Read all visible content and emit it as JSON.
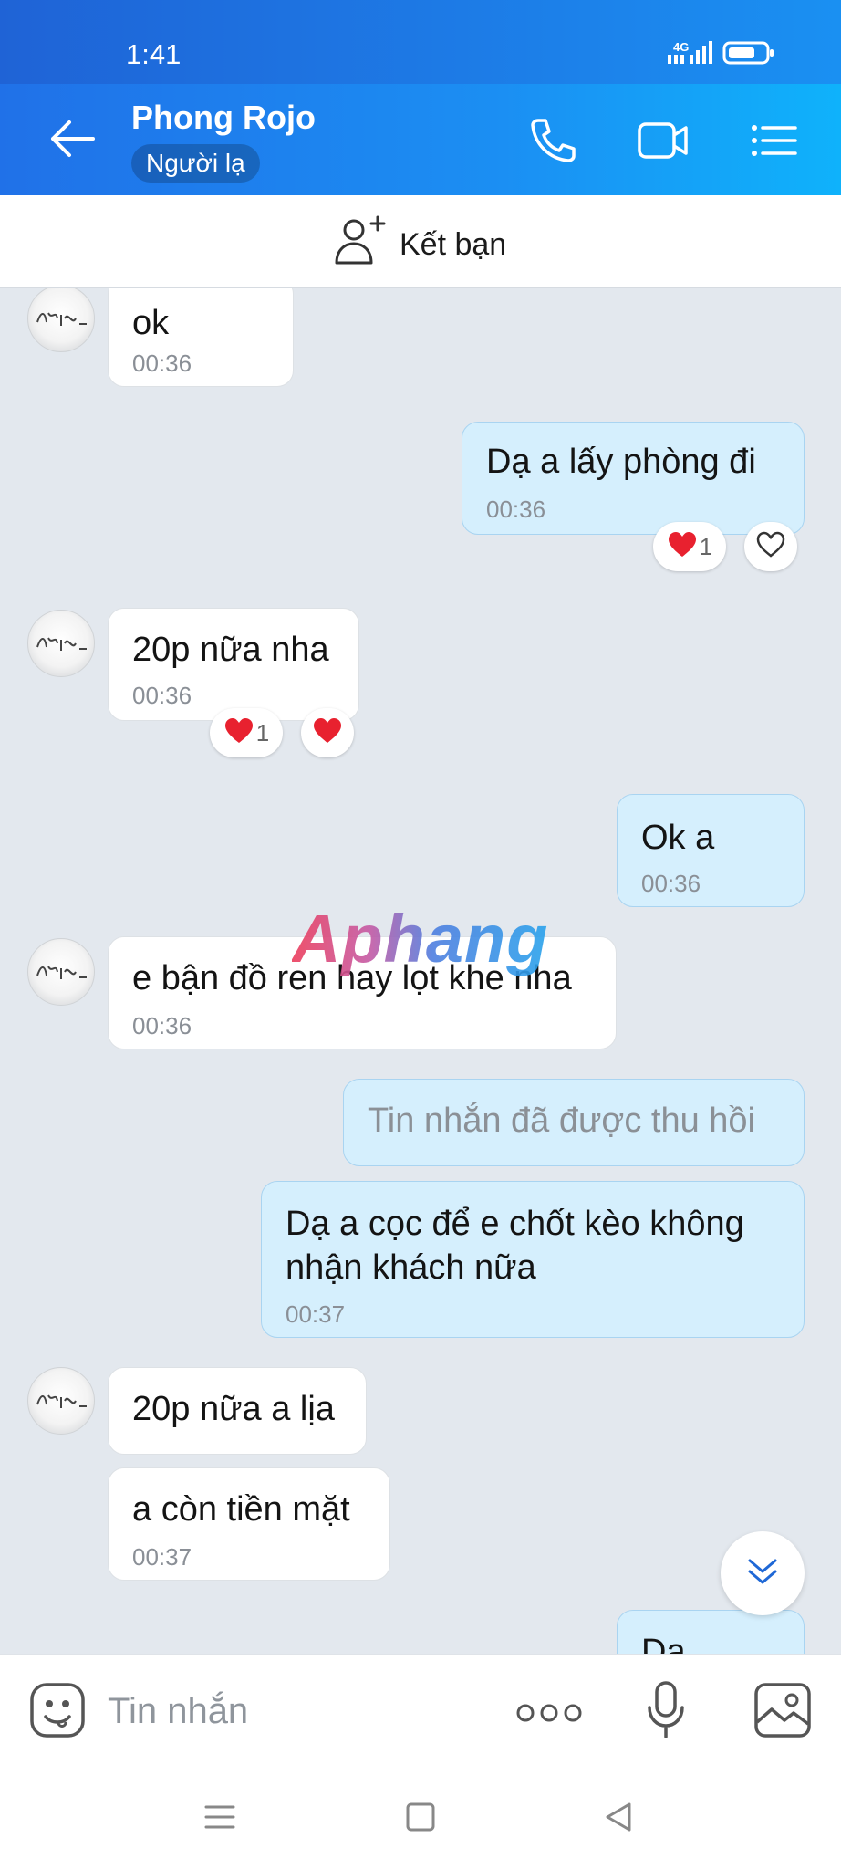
{
  "status_bar": {
    "time": "1:41",
    "network": "4G"
  },
  "header": {
    "title": "Phong Rojo",
    "badge": "Người lạ"
  },
  "add_friend": {
    "label": "Kết bạn"
  },
  "messages": [
    {
      "text": "ok",
      "time": "00:36"
    },
    {
      "text": "Dạ a lấy phòng đi",
      "time": "00:36",
      "reaction_count": "1"
    },
    {
      "text": "20p nữa nha",
      "time": "00:36",
      "reaction_count": "1"
    },
    {
      "text": "Ok a",
      "time": "00:36"
    },
    {
      "text": "e bận đồ ren hay lọt khe nha",
      "time": "00:36"
    },
    {
      "text": "Tin nhắn đã được thu hồi"
    },
    {
      "line1": "Dạ a cọc để e chốt kèo không",
      "line2": "nhận khách nữa",
      "time": "00:37"
    },
    {
      "text": "20p nữa a lịa"
    },
    {
      "text": "a còn tiền mặt",
      "time": "00:37"
    },
    {
      "text": "Dạ"
    }
  ],
  "watermark": "Aphang",
  "input": {
    "placeholder": "Tin nhắn"
  },
  "colors": {
    "header_start": "#1f63d6",
    "header_end": "#0fb2fb",
    "outgoing_bubble": "#d5effd",
    "incoming_bubble": "#ffffff",
    "heart": "#e8212f"
  }
}
